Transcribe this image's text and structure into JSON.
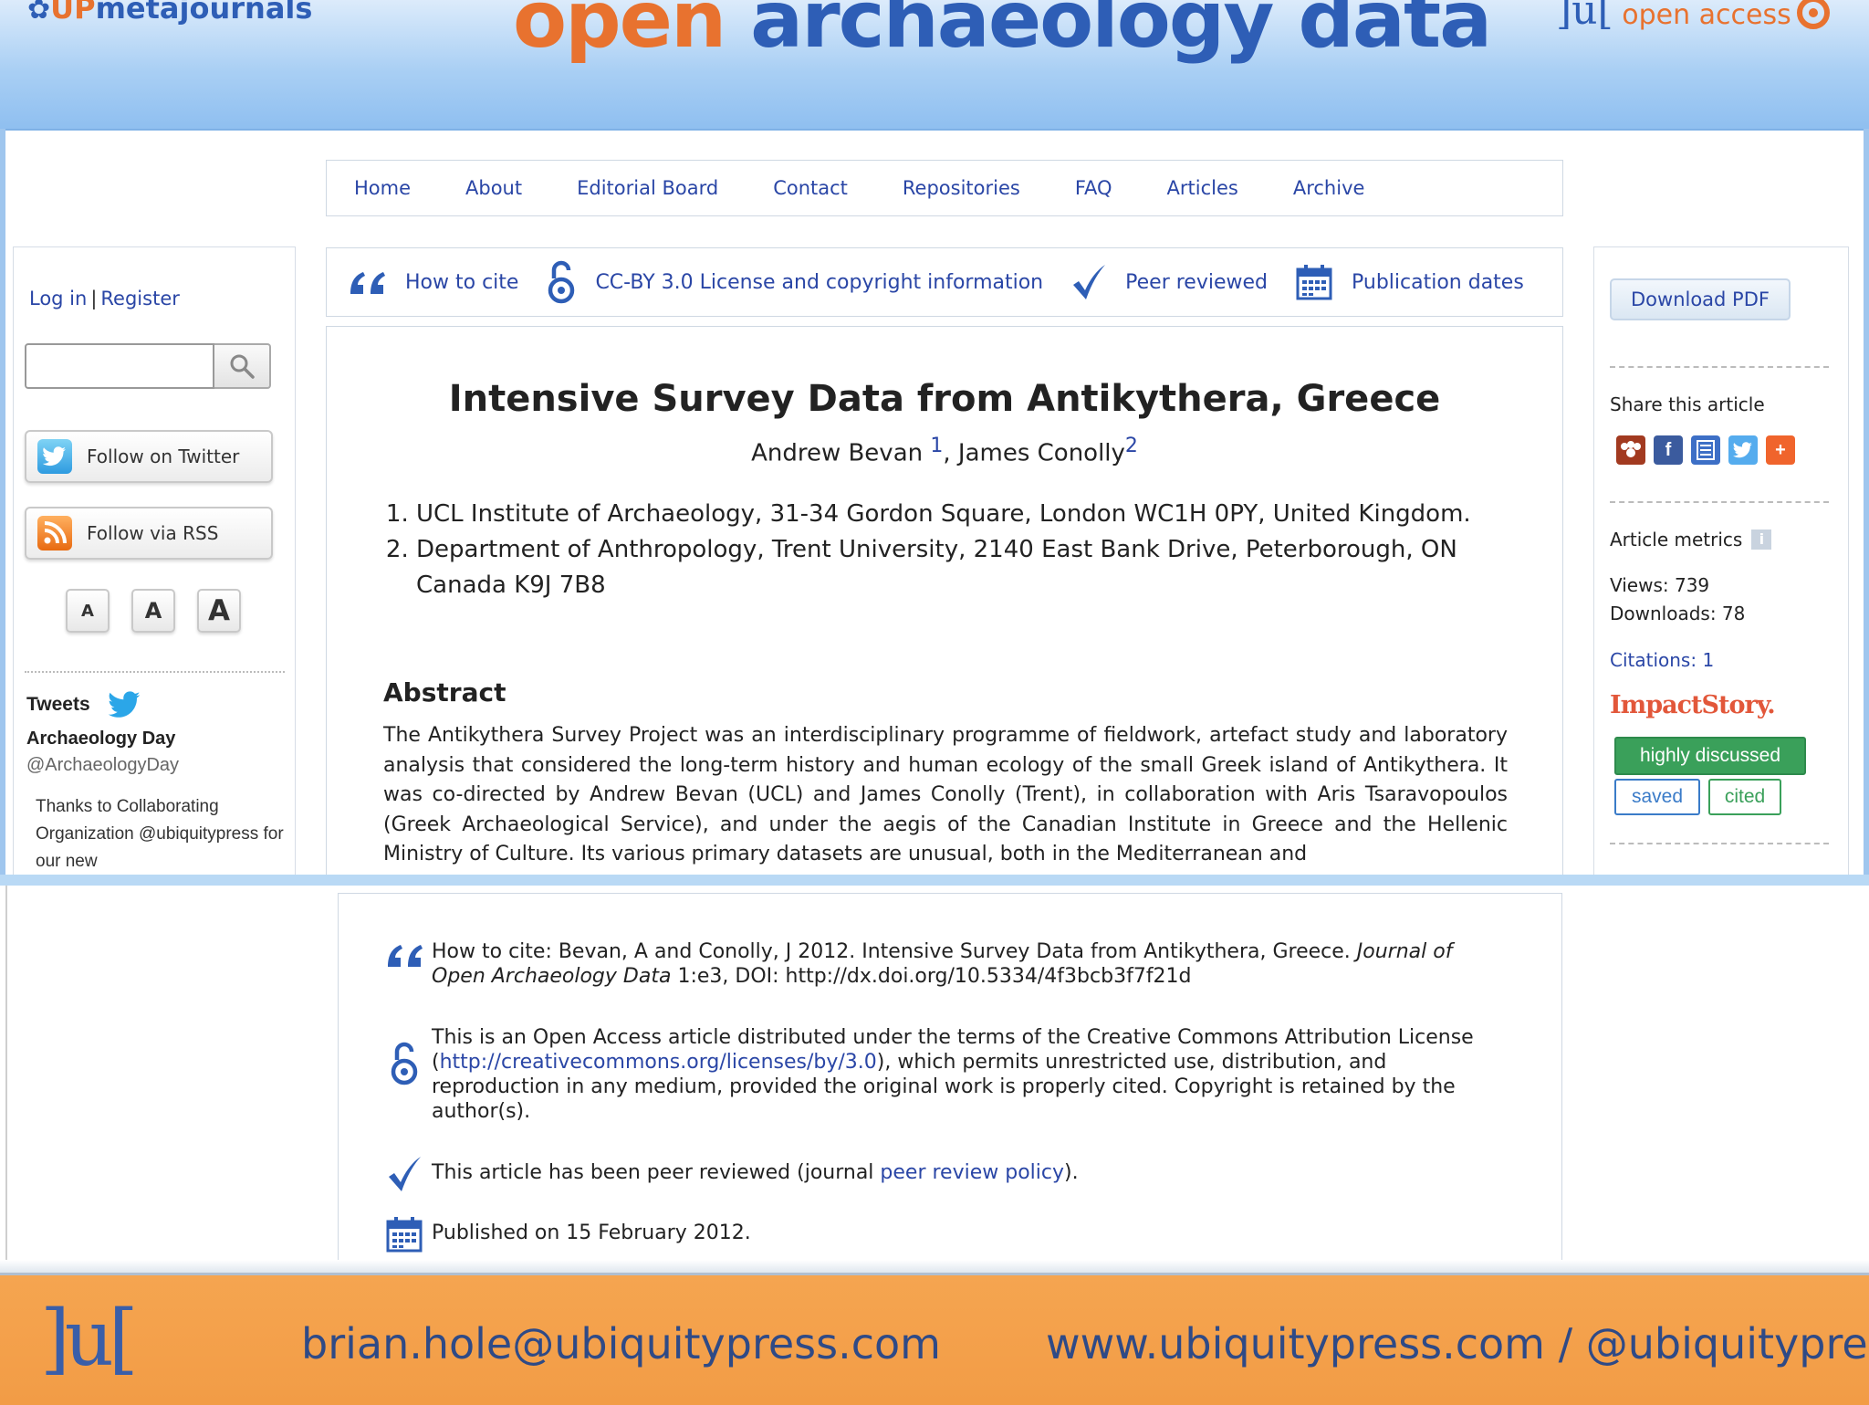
{
  "banner": {
    "brand_left_prefix": "UP",
    "brand_left_suffix": "metajournals",
    "title_open": "open",
    "title_rest": "archaeology data",
    "brand_right_mark": "]u[",
    "brand_right_text": "open access"
  },
  "nav": {
    "items": [
      "Home",
      "About",
      "Editorial Board",
      "Contact",
      "Repositories",
      "FAQ",
      "Articles",
      "Archive"
    ]
  },
  "left_sidebar": {
    "login": "Log in",
    "separator": "|",
    "register": "Register",
    "search_value": "",
    "twitter_button": "Follow on Twitter",
    "rss_button": "Follow via RSS",
    "font_sizes": [
      "A",
      "A",
      "A"
    ],
    "tweets_heading": "Tweets",
    "tweet_author": "Archaeology Day",
    "tweet_handle": "@ArchaeologyDay",
    "tweet_text": "Thanks to Collaborating Organization @ubiquitypress for our new"
  },
  "toolbar": {
    "how_to_cite": "How to cite",
    "license": "CC-BY 3.0 License and copyright information",
    "peer_reviewed": "Peer reviewed",
    "publication_dates": "Publication dates"
  },
  "article": {
    "title": "Intensive Survey Data from Antikythera, Greece",
    "author1": "Andrew Bevan",
    "author1_sup": "1",
    "author_sep": ", ",
    "author2": "James Conolly",
    "author2_sup": "2",
    "affiliations": [
      "UCL Institute of Archaeology, 31-34 Gordon Square, London WC1H 0PY, United Kingdom.",
      "Department of Anthropology, Trent University, 2140 East Bank Drive, Peterborough, ON Canada K9J 7B8"
    ],
    "abstract_heading": "Abstract",
    "abstract_text": "The Antikythera Survey Project was an interdisciplinary programme of fieldwork, artefact study and laboratory analysis that considered the long-term history and human ecology of the small Greek island of Antikythera. It was co-directed by Andrew Bevan (UCL) and James Conolly (Trent), in collaboration with Aris Tsaravopoulos (Greek Archaeological Service), and under the aegis of the Canadian Institute in Greece and the Hellenic Ministry of Culture. Its various primary datasets are unusual, both in the Mediterranean and"
  },
  "right_sidebar": {
    "download_pdf": "Download PDF",
    "share_heading": "Share this article",
    "metrics_heading": "Article metrics",
    "views": "Views: 739",
    "downloads": "Downloads: 78",
    "citations": "Citations: 1",
    "impactstory": "ImpactStory.",
    "badge_discussed": "highly discussed",
    "badge_saved": "saved",
    "badge_cited": "cited"
  },
  "details": {
    "cite_prefix": "How to cite: Bevan, A and Conolly, J 2012. Intensive Survey Data from Antikythera, Greece. ",
    "cite_journal": "Journal of Open Archaeology Data",
    "cite_suffix": " 1:e3, DOI: http://dx.doi.org/10.5334/4f3bcb3f7f21d",
    "license_prefix": "This is an Open Access article distributed under the terms of the Creative Commons Attribution License (",
    "license_link": "http://creativecommons.org/licenses/by/3.0",
    "license_suffix": "), which permits unrestricted use, distribution, and reproduction in any medium, provided the original work is properly cited. Copyright is retained by the author(s).",
    "peer_prefix": "This article has been peer reviewed (journal ",
    "peer_link": "peer review policy",
    "peer_suffix": ").",
    "published": "Published on 15 February 2012."
  },
  "footer": {
    "logo": "]u[",
    "email": "brian.hole@ubiquitypress.com",
    "web": "www.ubiquitypress.com / @ubiquitypress"
  },
  "colors": {
    "brand_orange": "#e8722f",
    "brand_blue": "#2e5eb6",
    "link_blue": "#2a46a6",
    "footer_orange": "#f29c46"
  }
}
